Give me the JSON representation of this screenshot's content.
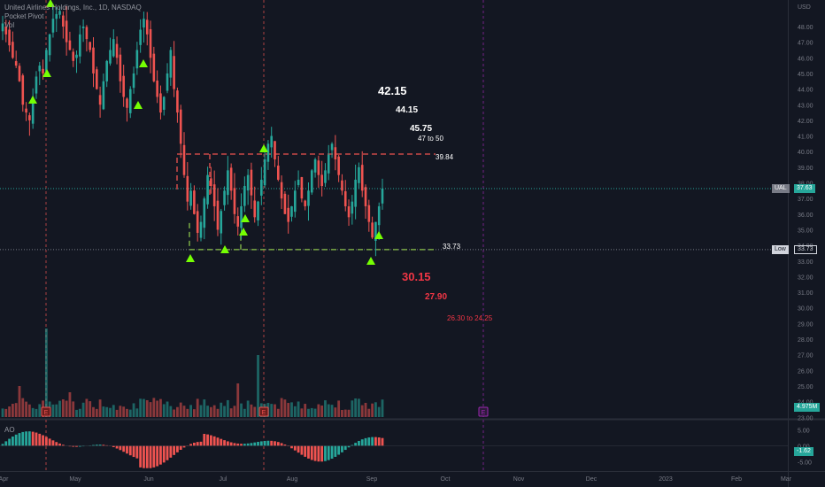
{
  "legend": {
    "symbol": "United Airlines Holdings, Inc., 1D, NASDAQ",
    "indicator1": "Pocket Pivot",
    "indicator2": "Vol",
    "ao": "AO"
  },
  "axis": {
    "currency": "USD",
    "price_ticks": [
      "48.00",
      "47.00",
      "46.00",
      "45.00",
      "44.00",
      "43.00",
      "42.00",
      "41.00",
      "40.00",
      "39.00",
      "38.00",
      "37.00",
      "36.00",
      "35.00",
      "34.00",
      "33.00",
      "32.00",
      "31.00",
      "30.00",
      "29.00",
      "28.00",
      "27.00",
      "26.00",
      "25.00",
      "24.00",
      "23.00"
    ],
    "ao_ticks": [
      "5.00",
      "0.00",
      "-5.00"
    ],
    "months": [
      "Apr",
      "May",
      "Jun",
      "Jul",
      "Aug",
      "Sep",
      "Oct",
      "Nov",
      "Dec",
      "2023",
      "Feb",
      "Mar"
    ]
  },
  "tags": {
    "ual_label": "UAL",
    "ual_price": "37.63",
    "low_label": "Low",
    "low_price": "33.73",
    "volume": "4.975M",
    "ao_value": "-1.62"
  },
  "projections": {
    "up1": "42.15",
    "up2": "44.15",
    "up3": "45.75",
    "up4": "47 to 50",
    "resistance": "39.84",
    "support": "33.73",
    "down1": "30.15",
    "down2": "27.90",
    "down3": "26.30 to 24.25"
  },
  "earnings_markers": [
    "E",
    "E",
    "E"
  ],
  "colors": {
    "up": "#26a69a",
    "down": "#ef5350",
    "pivot": "#76ff03",
    "resistance": "#ef5350",
    "support": "#8bc34a",
    "earnings_future": "#9c27b0"
  },
  "chart_data": {
    "type": "candlestick",
    "ylim": [
      23,
      49
    ],
    "ao_ylim": [
      -7.5,
      7.5
    ],
    "horizontal_levels": [
      {
        "value": 39.84,
        "style": "dashed",
        "color": "red"
      },
      {
        "value": 33.73,
        "style": "dashed",
        "color": "green"
      }
    ],
    "close_series_approx": [
      48.2,
      47.5,
      46.8,
      46.0,
      45.5,
      44.5,
      43.0,
      42.5,
      42.0,
      43.5,
      44.8,
      45.5,
      45.0,
      46.5,
      47.5,
      48.5,
      48.8,
      49.0,
      48.0,
      47.0,
      46.5,
      45.8,
      46.2,
      47.5,
      48.0,
      47.2,
      46.5,
      45.0,
      44.0,
      43.0,
      44.5,
      45.8,
      46.5,
      47.2,
      46.0,
      44.5,
      43.5,
      42.8,
      44.0,
      45.0,
      46.5,
      47.8,
      48.5,
      47.5,
      46.0,
      44.5,
      43.5,
      42.5,
      43.5,
      45.0,
      46.5,
      44.0,
      42.5,
      40.5,
      38.5,
      36.8,
      37.5,
      36.0,
      34.8,
      35.5,
      37.0,
      38.5,
      37.8,
      36.5,
      35.0,
      36.2,
      37.5,
      38.8,
      37.5,
      36.0,
      35.2,
      36.5,
      37.8,
      38.5,
      37.2,
      35.8,
      36.8,
      38.2,
      39.5,
      40.5,
      41.0,
      39.5,
      38.2,
      37.0,
      36.0,
      35.5,
      36.5,
      37.5,
      38.2,
      37.0,
      36.5,
      37.5,
      38.8,
      39.5,
      38.5,
      37.8,
      38.8,
      39.8,
      40.5,
      39.5,
      38.5,
      37.5,
      36.5,
      35.8,
      36.8,
      38.2,
      39.0,
      37.5,
      36.5,
      35.5,
      34.5,
      35.5,
      36.5,
      37.63
    ]
  }
}
